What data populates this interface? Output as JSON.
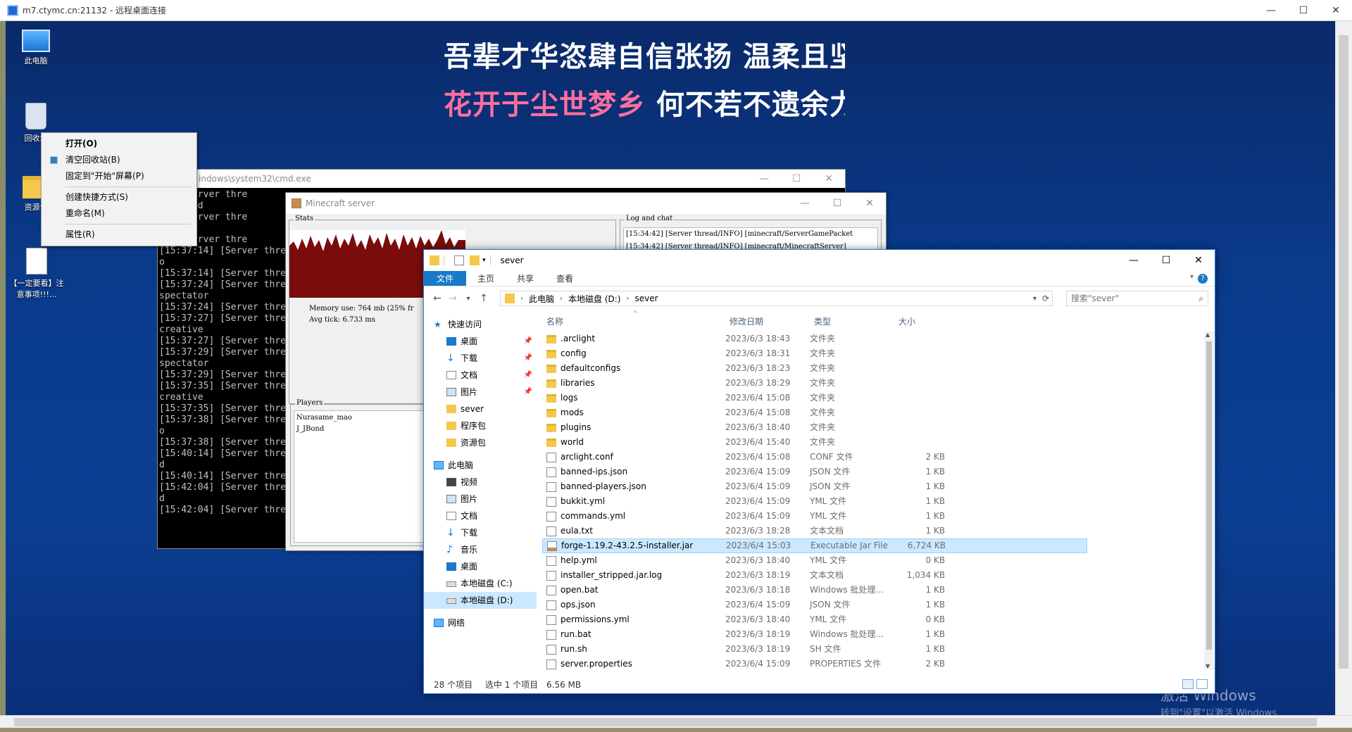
{
  "rdp": {
    "title": "m7.ctymc.cn:21132 - 远程桌面连接",
    "min": "—",
    "max": "☐",
    "close": "✕"
  },
  "wallpaper": {
    "line1": "吾辈才华恣肆自信张扬 温柔且坚强",
    "line2_pink": "花开于尘世梦乡",
    "line2_white": " 何不若不遗余力去"
  },
  "desktop_icons": [
    {
      "label": "此电脑"
    },
    {
      "label": "回收站"
    },
    {
      "label": "资源包"
    },
    {
      "label": "【一定要看】注意事项!!!..."
    }
  ],
  "context_menu": {
    "open": "打开(O)",
    "empty_bin": "清空回收站(B)",
    "pin_start": "固定到\"开始\"屏幕(P)",
    "create_shortcut": "创建快捷方式(S)",
    "rename": "重命名(M)",
    "properties": "属性(R)"
  },
  "cmd": {
    "title": "indows\\system32\\cmd.exe",
    "lines": "02] [Server thre\ns behind\n06] [Server thre\ne\n06] [Server thre\n[15:37:14] [Server thre\no\n[15:37:14] [Server thre\n[15:37:24] [Server thre\nspectator\n[15:37:24] [Server thre\n[15:37:27] [Server thre\ncreative\n[15:37:27] [Server thre\n[15:37:29] [Server thre\nspectator\n[15:37:29] [Server thre\n[15:37:35] [Server thre\ncreative\n[15:37:35] [Server thre\n[15:37:38] [Server thre\no\n[15:37:38] [Server thre\n[15:40:14] [Server thre\nd\n[15:40:14] [Server thre\n[15:42:04] [Server thre\nd\n[15:42:04] [Server thre"
  },
  "mc_server": {
    "title": "Minecraft server",
    "stats_label": "Stats",
    "memory": "Memory use: 764 mb (25% fr",
    "avg_tick": "Avg tick: 6.733 ms",
    "players_label": "Players",
    "players": [
      "Nurasame_mao",
      "J_JBond"
    ],
    "log_label": "Log and chat",
    "log_lines": "[15:34:42] [Server thread/INFO] [minecraft/ServerGamePacket\n[15:34:42] [Server thread/INFO] [minecraft/MinecraftServer]"
  },
  "explorer": {
    "title": "sever",
    "tabs": [
      "文件",
      "主页",
      "共享",
      "查看"
    ],
    "breadcrumb": [
      "此电脑",
      "本地磁盘 (D:)",
      "sever"
    ],
    "search_placeholder": "搜索\"sever\"",
    "columns": {
      "name": "名称",
      "date": "修改日期",
      "type": "类型",
      "size": "大小"
    },
    "nav": {
      "quick_access": "快速访问",
      "quick_items": [
        "桌面",
        "下载",
        "文档",
        "图片",
        "sever",
        "程序包",
        "资源包"
      ],
      "this_pc": "此电脑",
      "pc_items": [
        "视频",
        "图片",
        "文档",
        "下载",
        "音乐",
        "桌面",
        "本地磁盘 (C:)",
        "本地磁盘 (D:)"
      ],
      "network": "网络"
    },
    "files": [
      {
        "name": ".arclight",
        "date": "2023/6/3 18:43",
        "type": "文件夹",
        "size": "",
        "kind": "folder"
      },
      {
        "name": "config",
        "date": "2023/6/3 18:31",
        "type": "文件夹",
        "size": "",
        "kind": "folder"
      },
      {
        "name": "defaultconfigs",
        "date": "2023/6/3 18:23",
        "type": "文件夹",
        "size": "",
        "kind": "folder"
      },
      {
        "name": "libraries",
        "date": "2023/6/3 18:29",
        "type": "文件夹",
        "size": "",
        "kind": "folder"
      },
      {
        "name": "logs",
        "date": "2023/6/4 15:08",
        "type": "文件夹",
        "size": "",
        "kind": "folder"
      },
      {
        "name": "mods",
        "date": "2023/6/4 15:08",
        "type": "文件夹",
        "size": "",
        "kind": "folder"
      },
      {
        "name": "plugins",
        "date": "2023/6/3 18:40",
        "type": "文件夹",
        "size": "",
        "kind": "folder"
      },
      {
        "name": "world",
        "date": "2023/6/4 15:40",
        "type": "文件夹",
        "size": "",
        "kind": "folder"
      },
      {
        "name": "arclight.conf",
        "date": "2023/6/4 15:08",
        "type": "CONF 文件",
        "size": "2 KB",
        "kind": "file"
      },
      {
        "name": "banned-ips.json",
        "date": "2023/6/4 15:09",
        "type": "JSON 文件",
        "size": "1 KB",
        "kind": "file"
      },
      {
        "name": "banned-players.json",
        "date": "2023/6/4 15:09",
        "type": "JSON 文件",
        "size": "1 KB",
        "kind": "file"
      },
      {
        "name": "bukkit.yml",
        "date": "2023/6/4 15:09",
        "type": "YML 文件",
        "size": "1 KB",
        "kind": "file"
      },
      {
        "name": "commands.yml",
        "date": "2023/6/4 15:09",
        "type": "YML 文件",
        "size": "1 KB",
        "kind": "file"
      },
      {
        "name": "eula.txt",
        "date": "2023/6/3 18:28",
        "type": "文本文档",
        "size": "1 KB",
        "kind": "file"
      },
      {
        "name": "forge-1.19.2-43.2.5-installer.jar",
        "date": "2023/6/4 15:03",
        "type": "Executable Jar File",
        "size": "6,724 KB",
        "kind": "jar",
        "selected": true
      },
      {
        "name": "help.yml",
        "date": "2023/6/3 18:40",
        "type": "YML 文件",
        "size": "0 KB",
        "kind": "file"
      },
      {
        "name": "installer_stripped.jar.log",
        "date": "2023/6/3 18:19",
        "type": "文本文档",
        "size": "1,034 KB",
        "kind": "file"
      },
      {
        "name": "open.bat",
        "date": "2023/6/3 18:18",
        "type": "Windows 批处理...",
        "size": "1 KB",
        "kind": "file"
      },
      {
        "name": "ops.json",
        "date": "2023/6/4 15:09",
        "type": "JSON 文件",
        "size": "1 KB",
        "kind": "file"
      },
      {
        "name": "permissions.yml",
        "date": "2023/6/3 18:40",
        "type": "YML 文件",
        "size": "0 KB",
        "kind": "file"
      },
      {
        "name": "run.bat",
        "date": "2023/6/3 18:19",
        "type": "Windows 批处理...",
        "size": "1 KB",
        "kind": "file"
      },
      {
        "name": "run.sh",
        "date": "2023/6/3 18:19",
        "type": "SH 文件",
        "size": "1 KB",
        "kind": "file"
      },
      {
        "name": "server.properties",
        "date": "2023/6/4 15:09",
        "type": "PROPERTIES 文件",
        "size": "2 KB",
        "kind": "file"
      }
    ],
    "status": {
      "count": "28 个项目",
      "selected": "选中 1 个项目",
      "size": "6.56 MB"
    }
  },
  "watermark": {
    "line1": "激活 Windows",
    "line2": "转到\"设置\"以激活 Windows"
  }
}
